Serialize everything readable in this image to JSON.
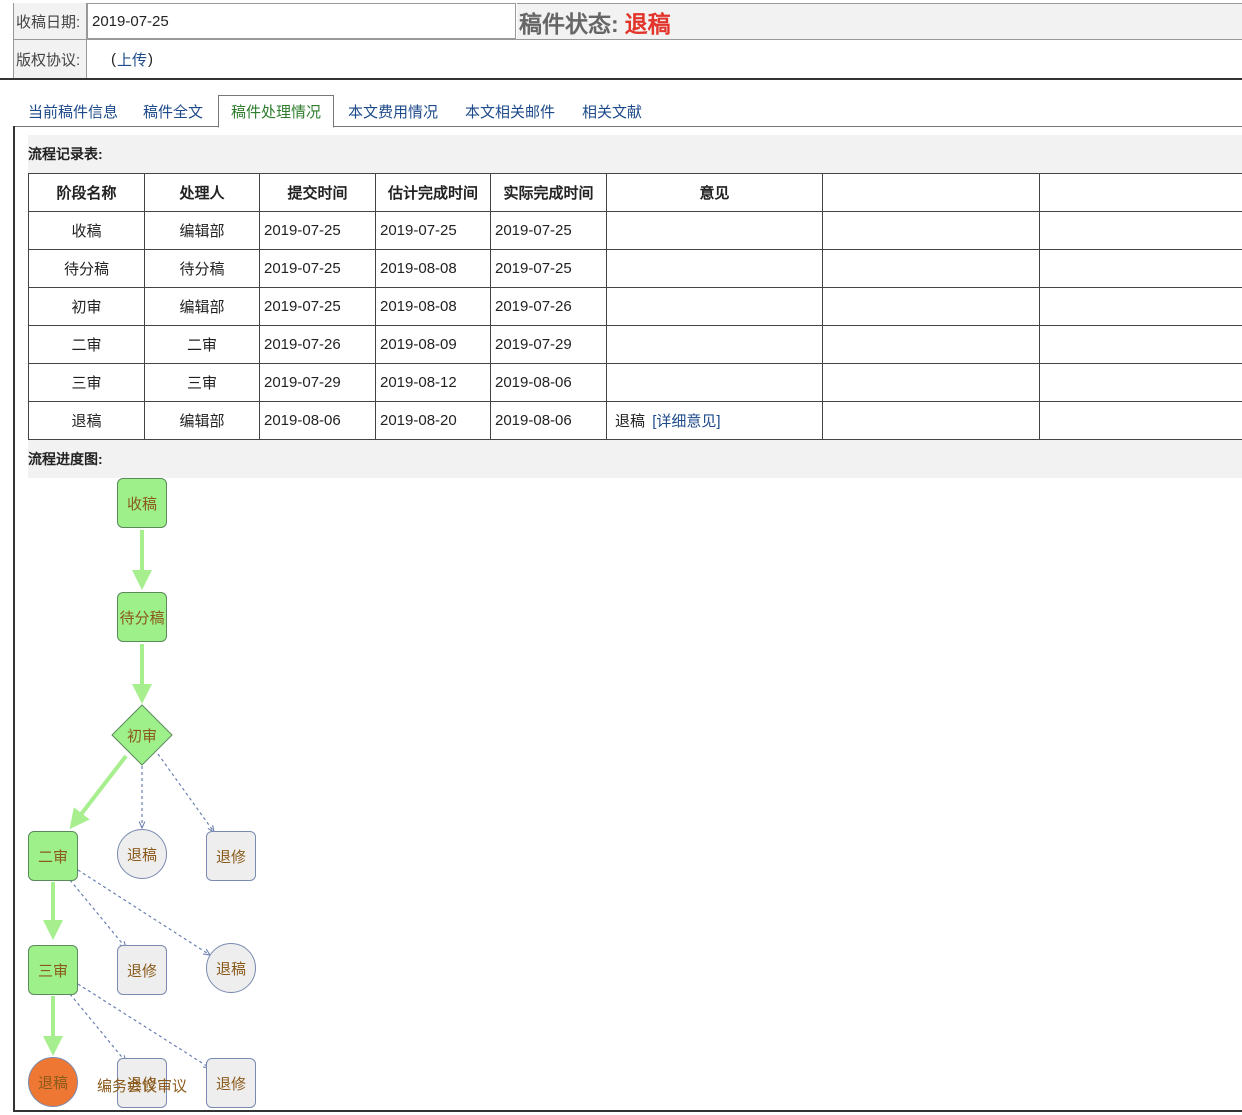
{
  "header": {
    "receive_date_label": "收稿日期:",
    "receive_date_value": "2019-07-25",
    "status_label": "稿件状态:",
    "status_value": "退稿",
    "copyright_label": "版权协议:",
    "upload_prefix": "(",
    "upload_link": "上传",
    "upload_suffix": ")"
  },
  "tabs": [
    {
      "label": "当前稿件信息"
    },
    {
      "label": "稿件全文"
    },
    {
      "label": "稿件处理情况"
    },
    {
      "label": "本文费用情况"
    },
    {
      "label": "本文相关邮件"
    },
    {
      "label": "相关文献"
    }
  ],
  "flow_record": {
    "title": "流程记录表:",
    "columns": [
      "阶段名称",
      "处理人",
      "提交时间",
      "估计完成时间",
      "实际完成时间",
      "意见",
      "",
      ""
    ],
    "rows": [
      [
        "收稿",
        "编辑部",
        "2019-07-25",
        "2019-07-25",
        "2019-07-25",
        ""
      ],
      [
        "待分稿",
        "待分稿",
        "2019-07-25",
        "2019-08-08",
        "2019-07-25",
        ""
      ],
      [
        "初审",
        "编辑部",
        "2019-07-25",
        "2019-08-08",
        "2019-07-26",
        ""
      ],
      [
        "二审",
        "二审",
        "2019-07-26",
        "2019-08-09",
        "2019-07-29",
        ""
      ],
      [
        "三审",
        "三审",
        "2019-07-29",
        "2019-08-12",
        "2019-08-06",
        ""
      ],
      [
        "退稿",
        "编辑部",
        "2019-08-06",
        "2019-08-20",
        "2019-08-06",
        "退稿"
      ]
    ],
    "detail_link": "[详细意见]"
  },
  "flow_chart": {
    "title": "流程进度图:",
    "nodes": {
      "receive": "收稿",
      "pending": "待分稿",
      "first": "初审",
      "first_reject": "退稿",
      "first_revise": "退修",
      "second": "二审",
      "second_revise": "退修",
      "second_reject": "退稿",
      "third": "三审",
      "third_revise": "退修",
      "third_meeting": "编务会议审议",
      "third_revise2": "退修",
      "final_reject": "退稿"
    },
    "colors": {
      "active": "#9ef08a",
      "pending": "#eeeeee",
      "current": "#ee7733",
      "arrow_active": "#a6ee8e",
      "arrow_pending": "#6a7fb0"
    }
  },
  "colors": {
    "status": "#e2342a",
    "link": "#1d4a8a",
    "active_tab": "#2d7d2d"
  }
}
